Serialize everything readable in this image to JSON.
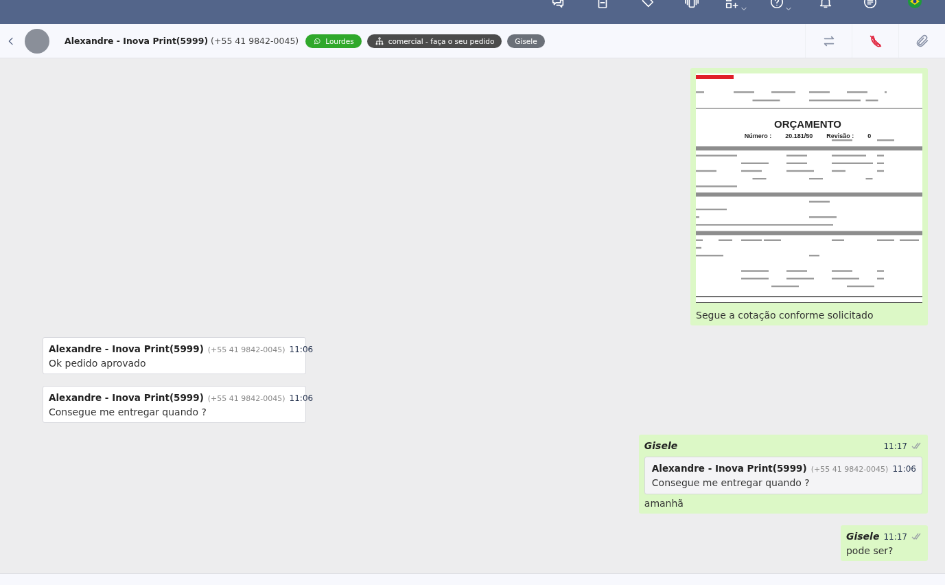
{
  "contact": {
    "name": "Alexandre - Inova Print(5999)",
    "phone": "(+55 41 9842-0045)"
  },
  "tags": [
    {
      "kind": "channel",
      "label": "Lourdes",
      "color": "#2fa82b"
    },
    {
      "kind": "queue",
      "label": "comercial - faça o seu pedido",
      "color": "#4b4b4b"
    },
    {
      "kind": "user",
      "label": "Gisele",
      "color": "#6b7078"
    }
  ],
  "messages": [
    {
      "kind": "image_out",
      "caption": "Segue a cotação conforme solicitado",
      "document": {
        "title": "ORÇAMENTO",
        "number_label": "Número :",
        "number": "20.181/50",
        "revision_label": "Revisão :",
        "revision": "0"
      }
    },
    {
      "kind": "text_in",
      "sender": "Alexandre - Inova Print(5999)",
      "phone": "(+55 41 9842-0045)",
      "time": "11:06",
      "text": "Ok pedido aprovado"
    },
    {
      "kind": "text_in",
      "sender": "Alexandre - Inova Print(5999)",
      "phone": "(+55 41 9842-0045)",
      "time": "11:06",
      "text": "Consegue me entregar quando ?"
    },
    {
      "kind": "reply_out",
      "sender": "Gisele",
      "time": "11:17",
      "quoted": {
        "sender": "Alexandre - Inova Print(5999)",
        "phone": "(+55 41 9842-0045)",
        "time": "11:06",
        "text": "Consegue me entregar quando ?"
      },
      "text": "amanhã"
    },
    {
      "kind": "text_out",
      "sender": "Gisele",
      "time": "11:17",
      "text": "pode ser?"
    }
  ]
}
